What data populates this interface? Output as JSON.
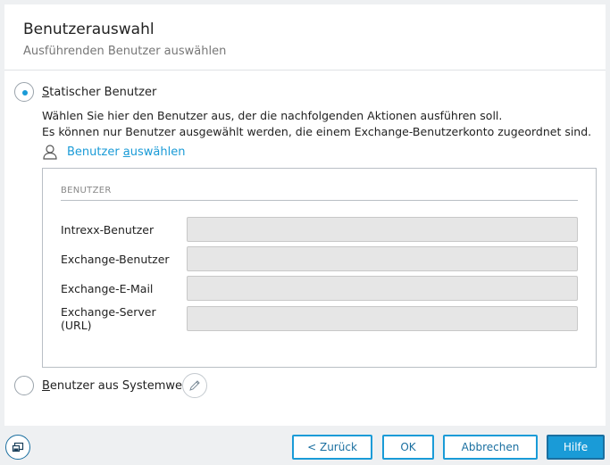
{
  "header": {
    "title": "Benutzerauswahl",
    "subtitle": "Ausführenden Benutzer auswählen"
  },
  "options": {
    "static": {
      "label_first": "S",
      "label_rest": "tatischer Benutzer",
      "checked": true
    },
    "system": {
      "label_first": "B",
      "label_rest": "enutzer aus Systemwert",
      "checked": false
    }
  },
  "description": {
    "line1": "Wählen Sie hier den Benutzer aus, der die nachfolgenden Aktionen ausführen soll.",
    "line2": "Es können nur Benutzer ausgewählt werden, die einem Exchange-Benutzerkonto zugeordnet sind."
  },
  "select_user": {
    "label_before": "Benutzer ",
    "label_underlined": "a",
    "label_after": "uswählen",
    "icon": "person-icon"
  },
  "panel": {
    "section_title": "BENUTZER",
    "fields": [
      {
        "label": "Intrexx-Benutzer",
        "value": ""
      },
      {
        "label": "Exchange-Benutzer",
        "value": ""
      },
      {
        "label": "Exchange-E-Mail",
        "value": ""
      },
      {
        "label": "Exchange-Server (URL)",
        "value": ""
      }
    ]
  },
  "buttons": {
    "back": "< Zurück",
    "ok": "OK",
    "cancel": "Abbrechen",
    "help": "Hilfe"
  },
  "colors": {
    "accent": "#1a9bd7",
    "accent_dark": "#1a6fa0",
    "input_bg": "#e6e6e6"
  }
}
